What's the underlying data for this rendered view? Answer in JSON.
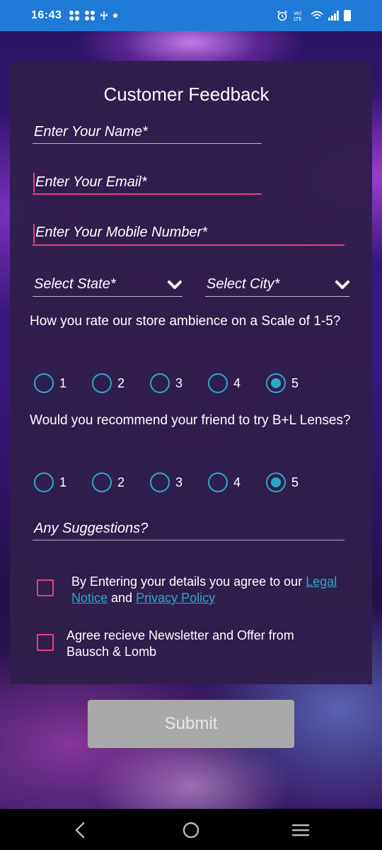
{
  "status_bar": {
    "time": "16:43",
    "left_icons": [
      "fan-icon",
      "fan-icon",
      "usb-icon",
      "dot-icon"
    ],
    "right_icons": [
      "alarm-icon",
      "volte-icon",
      "wifi-icon",
      "signal-icon",
      "battery-icon"
    ],
    "volte_label": "Vo)\nLTE",
    "color": "#1f7ad8"
  },
  "form": {
    "title": "Customer Feedback",
    "name_placeholder": "Enter Your Name*",
    "email_placeholder": "Enter Your Email*",
    "mobile_placeholder": "Enter Your Mobile Number*",
    "state_placeholder": "Select State*",
    "city_placeholder": "Select City*",
    "q1": {
      "text": "How you rate our store ambience on a Scale of 1-5?",
      "options": [
        "1",
        "2",
        "3",
        "4",
        "5"
      ],
      "selected": "5"
    },
    "q2": {
      "text": "Would you recommend your friend to try B+L Lenses?",
      "options": [
        "1",
        "2",
        "3",
        "4",
        "5"
      ],
      "selected": "5"
    },
    "suggestions_placeholder": "Any Suggestions?",
    "consent1": {
      "prefix": "By Entering your details you agree to our ",
      "legal_link": "Legal Notice",
      "and": " and ",
      "privacy_link": "Privacy Policy",
      "checked": false
    },
    "consent2": {
      "text": "Agree recieve Newsletter and Offer from Bausch & Lomb",
      "checked": false
    },
    "submit_label": "Submit"
  },
  "colors": {
    "accent_pink": "#e0427e",
    "accent_teal": "#2aa8c8",
    "card_bg": "#301e4c",
    "submit_bg": "#a9a9a9"
  },
  "nav": {
    "back": "back-icon",
    "home": "home-icon",
    "menu": "menu-icon"
  }
}
